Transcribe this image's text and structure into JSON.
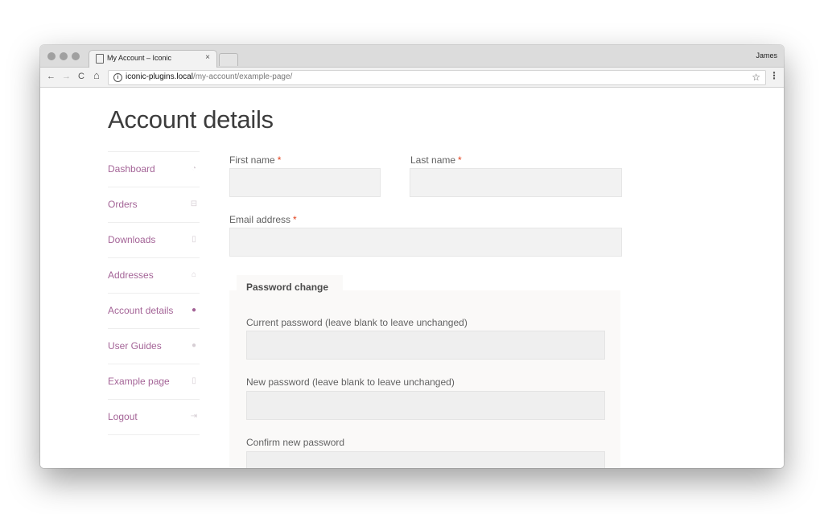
{
  "browser": {
    "tab_title": "My Account – Iconic",
    "tab_close": "×",
    "profile_name": "James",
    "back": "←",
    "forward": "→",
    "reload": "C",
    "home": "⌂",
    "info": "i",
    "url_host": "iconic-plugins.local",
    "url_path": "/my-account/example-page/",
    "star": "☆",
    "menu": "⋮"
  },
  "page": {
    "title": "Account details"
  },
  "nav": {
    "items": [
      {
        "label": "Dashboard",
        "icon": "dashboard-icon",
        "glyph": "◔"
      },
      {
        "label": "Orders",
        "icon": "basket-icon",
        "glyph": "⊟"
      },
      {
        "label": "Downloads",
        "icon": "file-download-icon",
        "glyph": "▯"
      },
      {
        "label": "Addresses",
        "icon": "home-icon",
        "glyph": "⌂"
      },
      {
        "label": "Account details",
        "icon": "user-icon",
        "glyph": "●"
      },
      {
        "label": "User Guides",
        "icon": "user-icon",
        "glyph": "●"
      },
      {
        "label": "Example page",
        "icon": "file-icon",
        "glyph": "▯"
      },
      {
        "label": "Logout",
        "icon": "sign-out-icon",
        "glyph": "⇥"
      }
    ],
    "active_index": 4
  },
  "form": {
    "first_name_label": "First name",
    "first_name_value": "",
    "last_name_label": "Last name",
    "last_name_value": "",
    "email_label": "Email address",
    "email_value": "",
    "required_mark": "*"
  },
  "password": {
    "legend": "Password change",
    "current_label": "Current password (leave blank to leave unchanged)",
    "new_label": "New password (leave blank to leave unchanged)",
    "confirm_label": "Confirm new password"
  },
  "colors": {
    "link": "#a46497",
    "required": "#e2401c",
    "input_bg": "#f2f2f2"
  }
}
